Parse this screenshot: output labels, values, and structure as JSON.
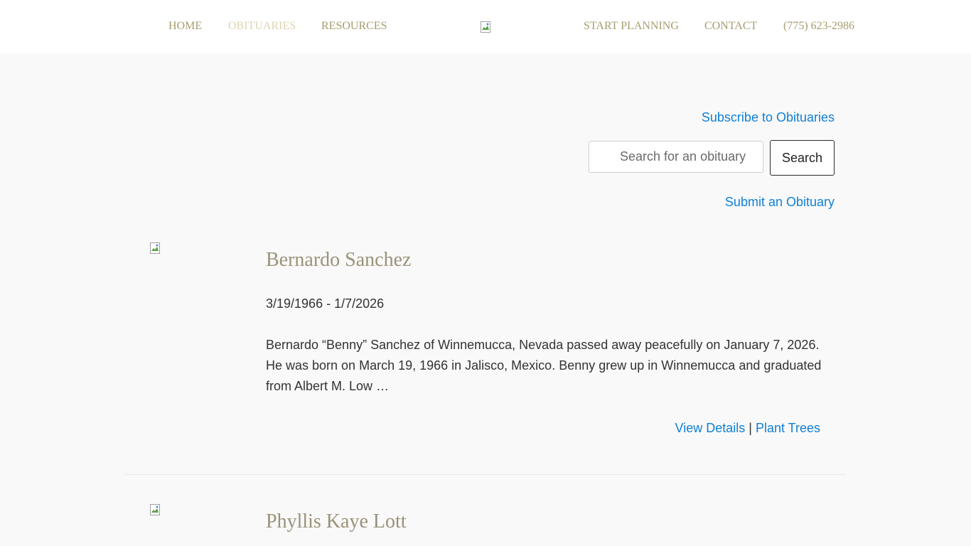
{
  "nav": {
    "home": "HOME",
    "obituaries": "OBITUARIES",
    "resources": "RESOURCES",
    "start_planning": "START PLANNING",
    "contact": "CONTACT",
    "phone": "(775) 623-2986"
  },
  "colors": {
    "nav_text": "#a79d6f",
    "nav_active": "#ddd4b2",
    "link_blue": "#0f7fd6",
    "name_color": "#9a9279",
    "page_bg": "#f9f9f9"
  },
  "actions": {
    "subscribe": "Subscribe to Obituaries",
    "search_placeholder": "Search for an obituary",
    "search_button": "Search",
    "submit": "Submit an Obituary"
  },
  "obituaries": [
    {
      "name": "Bernardo Sanchez",
      "dates": "3/19/1966 - 1/7/2026",
      "excerpt": "Bernardo “Benny” Sanchez of Winnemucca, Nevada passed away peacefully on January 7, 2026. He was born on March 19, 1966 in Jalisco, Mexico. Benny grew up in Winnemucca and graduated from Albert M. Low …",
      "view_details": "View Details",
      "separator": "|",
      "plant_trees": "Plant Trees"
    },
    {
      "name": "Phyllis Kaye Lott"
    }
  ]
}
